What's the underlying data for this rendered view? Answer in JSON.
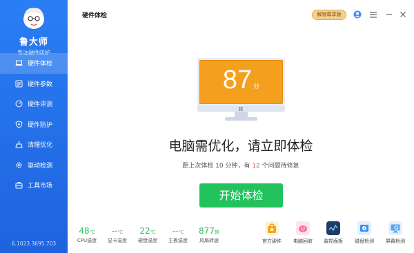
{
  "sidebar": {
    "brand": "鲁大师",
    "subtitle": "专注硬件防护",
    "items": [
      {
        "label": "硬件体检",
        "icon": "laptop-icon"
      },
      {
        "label": "硬件参数",
        "icon": "list-icon"
      },
      {
        "label": "硬件评测",
        "icon": "gauge-icon"
      },
      {
        "label": "硬件防护",
        "icon": "shield-icon"
      },
      {
        "label": "清理优化",
        "icon": "broom-icon"
      },
      {
        "label": "驱动检测",
        "icon": "gear-icon"
      },
      {
        "label": "工具市场",
        "icon": "toolbox-icon"
      }
    ],
    "version": "6.1023.3695.703"
  },
  "topbar": {
    "title": "硬件体检",
    "unlock_label": "解锁尊享版"
  },
  "main": {
    "score": "87",
    "score_unit": "分",
    "headline": "电脑需优化，请立即体检",
    "sub_prefix": "距上次体检 10 分钟，有 ",
    "sub_count": "12",
    "sub_suffix": " 个问题待修复",
    "start_label": "开始体检"
  },
  "stats": [
    {
      "value": "48",
      "unit": "℃",
      "label": "CPU温度",
      "active": true
    },
    {
      "value": "--",
      "unit": "℃",
      "label": "显卡温度",
      "active": false
    },
    {
      "value": "22",
      "unit": "℃",
      "label": "硬盘温度",
      "active": true
    },
    {
      "value": "--",
      "unit": "℃",
      "label": "主板温度",
      "active": false
    },
    {
      "value": "877",
      "unit": "转",
      "label": "风扇转速",
      "active": true
    }
  ],
  "tools": [
    {
      "label": "官方硬件",
      "icon": "shopping-bag-icon",
      "color": "#f5a623"
    },
    {
      "label": "电脑回收",
      "icon": "piggy-bank-icon",
      "color": "#ff6f9c"
    },
    {
      "label": "监控面板",
      "icon": "monitor-panel-icon",
      "color": "#1f3c66"
    },
    {
      "label": "磁盘检测",
      "icon": "disk-icon",
      "color": "#3a8df0"
    },
    {
      "label": "屏幕检测",
      "icon": "screen-check-icon",
      "color": "#5aa7f5"
    }
  ]
}
